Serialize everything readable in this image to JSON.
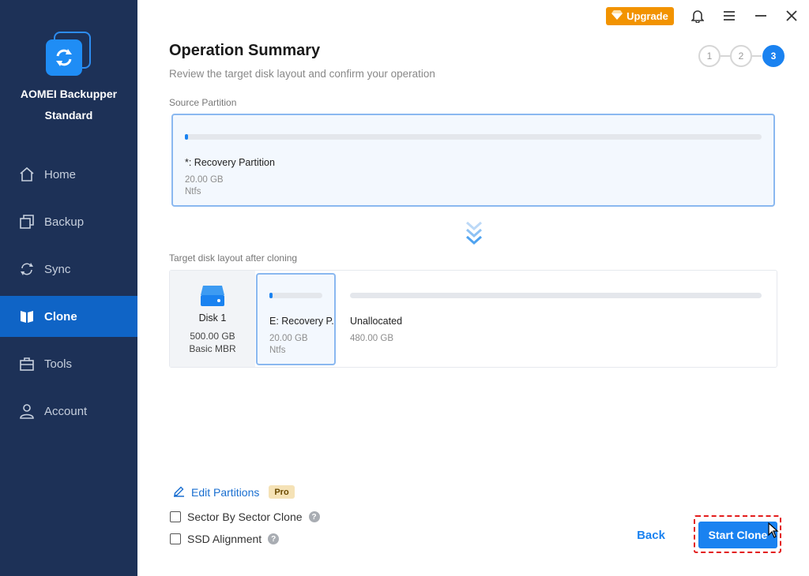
{
  "app": {
    "name": "AOMEI Backupper",
    "edition": "Standard"
  },
  "sidebar": {
    "items": [
      {
        "label": "Home",
        "icon": "home-icon"
      },
      {
        "label": "Backup",
        "icon": "backup-icon"
      },
      {
        "label": "Sync",
        "icon": "sync-icon"
      },
      {
        "label": "Clone",
        "icon": "clone-icon",
        "active": true
      },
      {
        "label": "Tools",
        "icon": "tools-icon"
      },
      {
        "label": "Account",
        "icon": "account-icon"
      }
    ]
  },
  "topbar": {
    "upgrade_label": "Upgrade"
  },
  "header": {
    "title": "Operation Summary",
    "subtitle": "Review the target disk layout and confirm your operation",
    "steps": [
      "1",
      "2",
      "3"
    ],
    "active_step": 3
  },
  "source": {
    "label": "Source Partition",
    "partition": {
      "name": "*: Recovery Partition",
      "size": "20.00 GB",
      "fs": "Ntfs"
    }
  },
  "target": {
    "label": "Target disk layout after cloning",
    "disk": {
      "name": "Disk 1",
      "size": "500.00 GB",
      "type": "Basic MBR"
    },
    "partition": {
      "name": "E: Recovery P...",
      "size": "20.00 GB",
      "fs": "Ntfs"
    },
    "unallocated": {
      "name": "Unallocated",
      "size": "480.00 GB"
    }
  },
  "options": {
    "edit_partitions": "Edit Partitions",
    "pro_badge": "Pro",
    "sector_by_sector": "Sector By Sector Clone",
    "ssd_alignment": "SSD Alignment"
  },
  "footer": {
    "back_label": "Back",
    "start_label": "Start Clone"
  },
  "colors": {
    "sidebar_bg": "#1d3157",
    "accent": "#1a82f0",
    "upgrade": "#f29300",
    "highlight": "#e31c1c"
  }
}
